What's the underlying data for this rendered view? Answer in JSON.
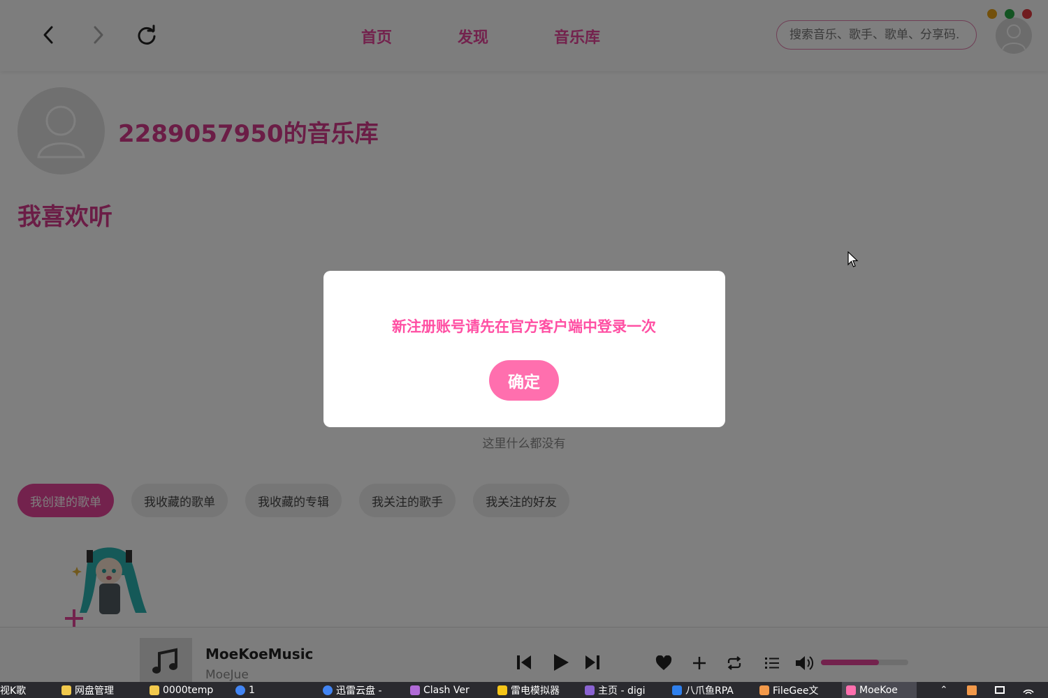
{
  "header": {
    "nav": {
      "home": "首页",
      "discover": "发现",
      "library": "音乐库"
    },
    "search": {
      "placeholder": "搜索音乐、歌手、歌单、分享码."
    },
    "window_buttons": {
      "minimize_color": "#e6a116",
      "maximize_color": "#27a844",
      "close_color": "#e0383e"
    },
    "icons": {
      "back": "chevron-left-icon",
      "forward": "chevron-right-icon",
      "refresh": "refresh-icon",
      "user": "user-icon"
    }
  },
  "profile": {
    "title": "2289057950的音乐库"
  },
  "favorites": {
    "title": "我喜欢听",
    "empty_text": "这里什么都没有"
  },
  "tabs": [
    {
      "label": "我创建的歌单",
      "active": true
    },
    {
      "label": "我收藏的歌单",
      "active": false
    },
    {
      "label": "我收藏的专辑",
      "active": false
    },
    {
      "label": "我关注的歌手",
      "active": false
    },
    {
      "label": "我关注的好友",
      "active": false
    }
  ],
  "player": {
    "title": "MoeKoeMusic",
    "artist": "MoeJue",
    "volume_fraction": 0.66,
    "icons": [
      "music-note-icon",
      "previous-icon",
      "play-icon",
      "next-icon",
      "heart-icon",
      "plus-icon",
      "repeat-icon",
      "playlist-icon",
      "volume-icon"
    ]
  },
  "dialog": {
    "message": "新注册账号请先在官方客户端中登录一次",
    "confirm_label": "确定"
  },
  "taskbar": {
    "items": [
      {
        "label": "视K歌"
      },
      {
        "label": "网盘管理"
      },
      {
        "label": "0000temp"
      },
      {
        "label": "1"
      },
      {
        "label": "迅雷云盘 -"
      },
      {
        "label": "Clash Ver"
      },
      {
        "label": "雷电模拟器"
      },
      {
        "label": "主页 - digi"
      },
      {
        "label": "八爪鱼RPA"
      },
      {
        "label": "FileGee文"
      },
      {
        "label": "MoeKoe"
      }
    ]
  },
  "colors": {
    "accent": "#e6459a",
    "dialog_text": "#ff4fa3",
    "dialog_button": "#ff6fae"
  }
}
